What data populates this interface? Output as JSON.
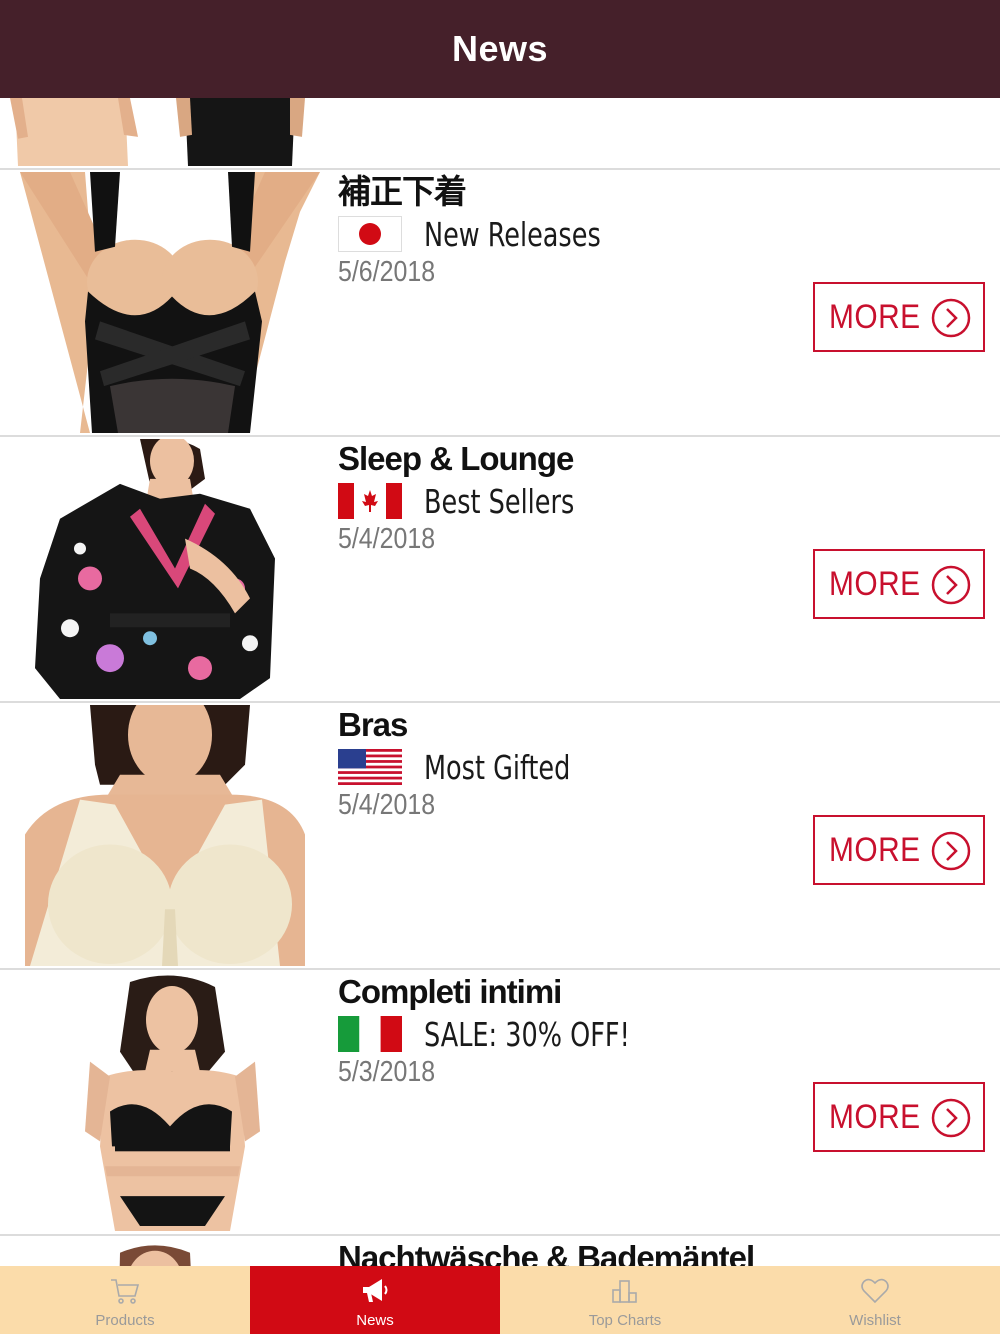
{
  "navbar": {
    "title": "News"
  },
  "rows": [
    {
      "category": "補正下着",
      "flag": "japan",
      "product_type": "New Releases",
      "date": "5/6/2018",
      "more_label": "MORE"
    },
    {
      "category": "Sleep & Lounge",
      "flag": "canada",
      "product_type": "Best Sellers",
      "date": "5/4/2018",
      "more_label": "MORE"
    },
    {
      "category": "Bras",
      "flag": "usa",
      "product_type": "Most Gifted",
      "date": "5/4/2018",
      "more_label": "MORE"
    },
    {
      "category": "Completi intimi",
      "flag": "italy",
      "product_type": "SALE: 30% OFF!",
      "date": "5/3/2018",
      "more_label": "MORE"
    },
    {
      "category": "Nachtwäsche & Bademäntel"
    }
  ],
  "tabbar": {
    "tabs": [
      {
        "label": "Products",
        "icon": "cart-icon"
      },
      {
        "label": "News",
        "icon": "megaphone-icon",
        "active": true
      },
      {
        "label": "Top Charts",
        "icon": "bar-chart-icon"
      },
      {
        "label": "Wishlist",
        "icon": "heart-icon"
      }
    ]
  },
  "colors": {
    "navbar": "#45202a",
    "accent": "#c8102e",
    "tabbar": "#fbdcaa",
    "active_tab": "#d10a14"
  }
}
